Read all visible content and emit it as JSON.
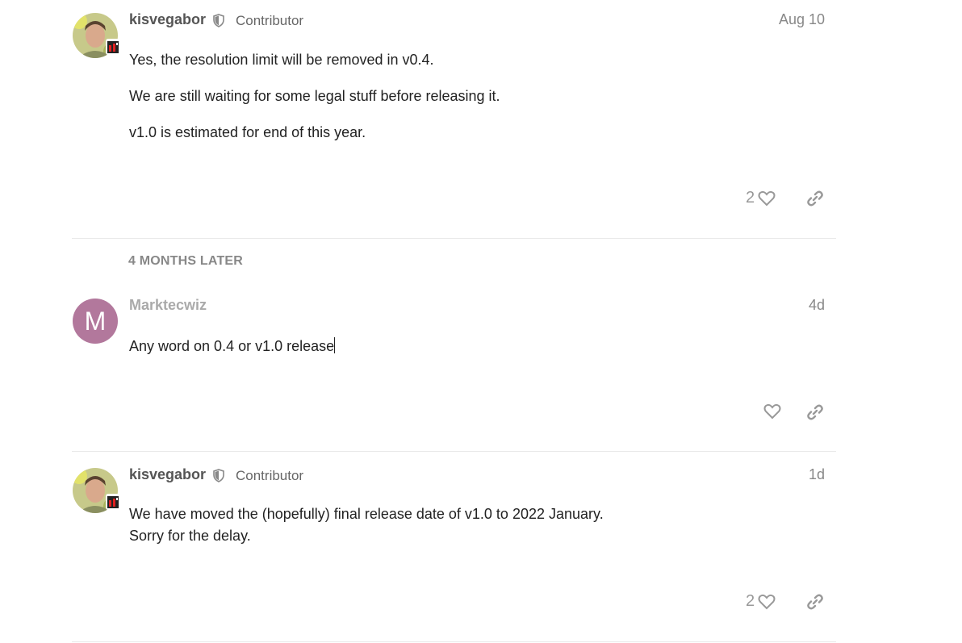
{
  "posts": [
    {
      "username": "kisvegabor",
      "user_title": "Contributor",
      "date": "Aug 10",
      "paragraphs": [
        "Yes, the resolution limit will be removed in v0.4.",
        "We are still waiting for some legal stuff before releasing it.",
        "v1.0 is estimated for end of this year."
      ],
      "like_count": "2",
      "avatar_icon": "user-photo"
    },
    {
      "username": "Marktecwiz",
      "avatar_letter": "M",
      "date": "4d",
      "paragraphs": [
        "Any word on 0.4 or v1.0 release"
      ],
      "like_count": ""
    },
    {
      "username": "kisvegabor",
      "user_title": "Contributor",
      "date": "1d",
      "paragraphs": [
        "We have moved the (hopefully) final release date of v1.0 to 2022 January.",
        "Sorry for the delay."
      ],
      "like_count": "2",
      "avatar_icon": "user-photo"
    }
  ],
  "time_gap": "4 MONTHS LATER",
  "colors": {
    "avatar_m": "#b2789c",
    "username": "#555555",
    "muted": "#999999",
    "divider": "#e9e9e9"
  },
  "icons": [
    "shield-icon",
    "heart-icon",
    "link-icon",
    "flair-icon"
  ]
}
